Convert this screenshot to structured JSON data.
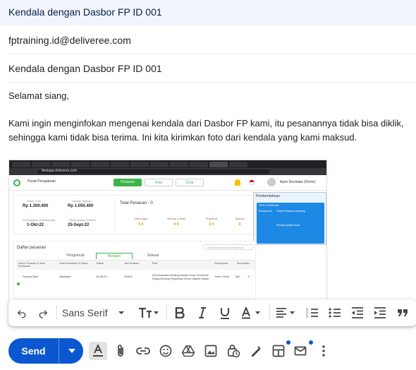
{
  "compose": {
    "title": "Kendala dengan Dasbor FP ID 001",
    "recipient": "fptraining.id@deliveree.com",
    "subject": "Kendala dengan Dasbor FP ID 001",
    "greeting": "Selamat siang,",
    "paragraph": "Kami ingin menginfokan mengenai kendala dari Dasbor FP kami, itu pesanannya tidak bisa diklik, sehingga kami tidak bisa terima. Ini kita kirimkan foto dari kendala yang kami maksud."
  },
  "embedded_screenshot": {
    "url": "fleetapp.deliveree.com",
    "location": "Pusat Pengaturan",
    "nav": [
      "Pesanan",
      "Peta",
      "Chat"
    ],
    "user": "Ayen Devinata (Demo)",
    "summary": {
      "label1": "Saldo Limit",
      "value1": "Rp 1.300.400",
      "label2": "Jumlah Tagihan",
      "value2": "Rp 1.050.400",
      "label3": "Pembayaran Sebelumnya",
      "value3": "1-Okt-22",
      "label4": "Pembayaran Terakhir",
      "value4": "25-Sept-22",
      "total": "Total Pesanan - 0",
      "stats": [
        {
          "label": "Menunggu",
          "value": "0 0"
        },
        {
          "label": "Menuju Lokasi",
          "value": "0 0"
        },
        {
          "label": "Terjadwal",
          "value": "0 0"
        },
        {
          "label": "Selesai",
          "value": "0"
        }
      ]
    },
    "notification": {
      "header": "Pemberitahuan",
      "bar": "TIPS & PANDUAN",
      "line1": "Pesanan ini",
      "line2": "Terima Pesanan sekarang",
      "line3": "Perbarui jadwal Anda"
    },
    "orders": {
      "header": "Daftar pesanan",
      "search": "Cari berdasarkan pengemudi",
      "tabs": [
        "Pengemudi",
        "Berjalan",
        "Selesai"
      ],
      "columns": [
        "Nomor Pesanan & Jenis Kendaraan",
        "Jenis Kendaraan & Status",
        "Jadwal",
        "Jam Pesanan",
        "Rute",
        "Pembayaran",
        "Sisa Waktu"
      ],
      "row": [
        "Pesanan Baru",
        "Dibatalkan",
        "15-Okt-22",
        "25/8/22",
        "DR-Kecamatan Menteng Jakarta Pusat, Pembersih Ruang Menteng Pengiriman Gelora Jakarta Selatan",
        "Tunai / Kredit",
        "Rp0",
        "0"
      ]
    }
  },
  "toolbar": {
    "font": "Sans Serif"
  },
  "actions": {
    "send": "Send"
  },
  "colors": {
    "send_blue": "#0b57d0",
    "title_bg": "#f2f6fc",
    "deliveree_green": "#3bb54a"
  }
}
